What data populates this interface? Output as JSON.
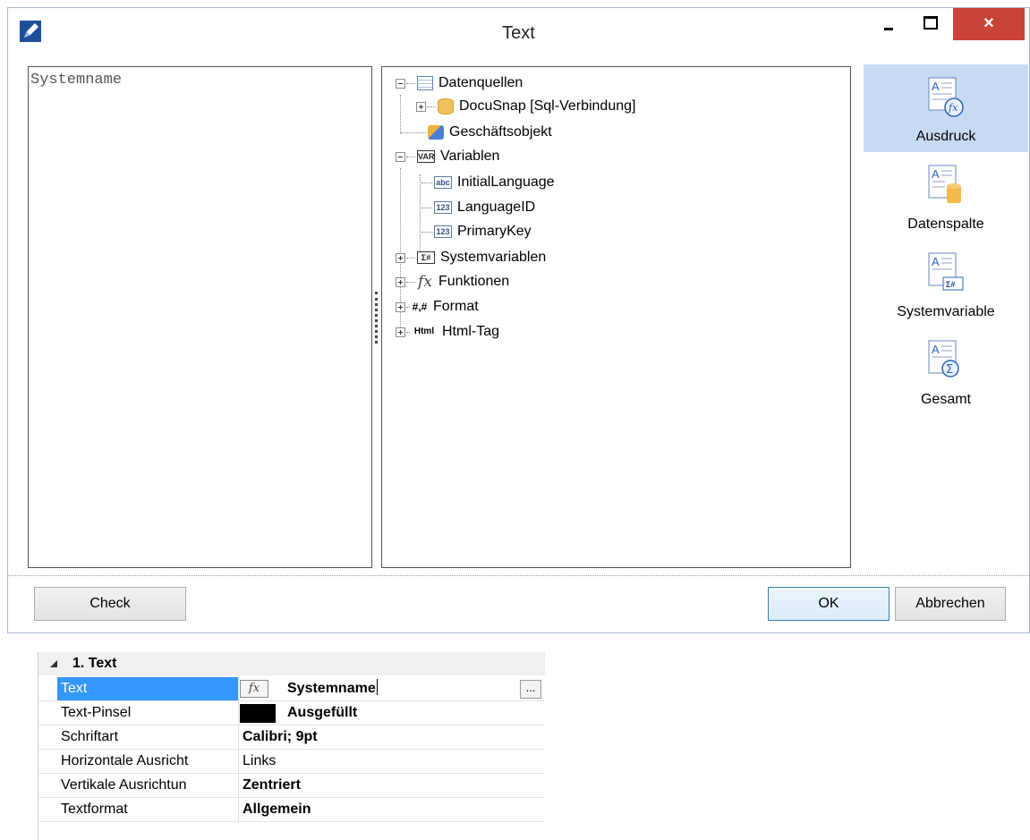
{
  "window": {
    "title": "Text",
    "close_glyph": "×"
  },
  "expression": {
    "value": "Systemname"
  },
  "tree": {
    "items": [
      {
        "label": "Datenquellen",
        "icon": "table-icon"
      },
      {
        "label": "DocuSnap [Sql-Verbindung]",
        "icon": "database-icon"
      },
      {
        "label": "Geschäftsobjekt",
        "icon": "business-object-icon"
      },
      {
        "label": "Variablen",
        "icon": "var-icon",
        "icon_text": "VAR"
      },
      {
        "label": "InitialLanguage",
        "icon": "string-variable-icon",
        "icon_text": "abc"
      },
      {
        "label": "LanguageID",
        "icon": "number-variable-icon",
        "icon_text": "123"
      },
      {
        "label": "PrimaryKey",
        "icon": "number-variable-icon",
        "icon_text": "123"
      },
      {
        "label": "Systemvariablen",
        "icon": "system-variable-icon",
        "icon_text": "Σ#"
      },
      {
        "label": "Funktionen",
        "icon": "fx-icon",
        "icon_text": "fx"
      },
      {
        "label": "Format",
        "icon": "format-icon",
        "icon_text": "#,#"
      },
      {
        "label": "Html-Tag",
        "icon": "html-icon",
        "icon_text": "Html"
      }
    ]
  },
  "palette": {
    "items": [
      {
        "label": "Ausdruck",
        "icon": "expression-icon",
        "active": true
      },
      {
        "label": "Datenspalte",
        "icon": "data-column-icon",
        "active": false
      },
      {
        "label": "Systemvariable",
        "icon": "system-variable-icon",
        "active": false
      },
      {
        "label": "Gesamt",
        "icon": "total-icon",
        "active": false
      }
    ]
  },
  "buttons": {
    "check": "Check",
    "ok": "OK",
    "cancel": "Abbrechen"
  },
  "property_grid": {
    "category": "1. Text",
    "rows": [
      {
        "name": "Text",
        "value": "Systemname",
        "fx": "fx",
        "ellipsis": "...",
        "selected": true
      },
      {
        "name": "Text-Pinsel",
        "value": "Ausgefüllt"
      },
      {
        "name": "Schriftart",
        "value": "Calibri; 9pt"
      },
      {
        "name": "Horizontale Ausricht",
        "value": "Links"
      },
      {
        "name": "Vertikale Ausrichtun",
        "value": "Zentriert"
      },
      {
        "name": "Textformat",
        "value": "Allgemein"
      }
    ]
  }
}
